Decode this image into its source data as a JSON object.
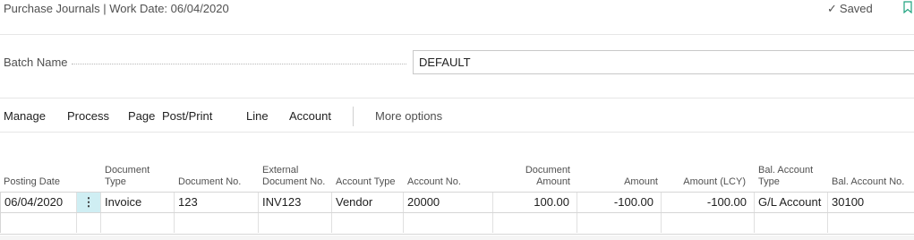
{
  "header": {
    "title": "Purchase Journals | Work Date: 06/04/2020",
    "saved_label": "Saved",
    "saved_icon": "check-icon",
    "bookmark_icon": "bookmark-icon",
    "bookmark_color": "#1fa37f"
  },
  "batch": {
    "label": "Batch Name",
    "value": "DEFAULT"
  },
  "menu": {
    "items": [
      "Manage",
      "Process",
      "Page",
      "Post/Print",
      "Line",
      "Account"
    ],
    "more": "More options"
  },
  "grid": {
    "columns": [
      {
        "label": "Posting Date"
      },
      {
        "label": ""
      },
      {
        "label": "Document Type"
      },
      {
        "label": "Document No."
      },
      {
        "label": "External Document No."
      },
      {
        "label": "Account Type"
      },
      {
        "label": "Account No."
      },
      {
        "label": "Document Amount"
      },
      {
        "label": "Amount"
      },
      {
        "label": "Amount (LCY)"
      },
      {
        "label": "Bal. Account Type"
      },
      {
        "label": "Bal. Account No."
      }
    ],
    "rows": [
      {
        "posting_date": "06/04/2020",
        "menu": "⋮",
        "document_type": "Invoice",
        "document_no": "123",
        "external_document_no": "INV123",
        "account_type": "Vendor",
        "account_no": "20000",
        "document_amount": "100.00",
        "amount": "-100.00",
        "amount_lcy": "-100.00",
        "bal_account_type": "G/L Account",
        "bal_account_no": "30100"
      }
    ],
    "selected_cell_color": "#cfeef3"
  }
}
